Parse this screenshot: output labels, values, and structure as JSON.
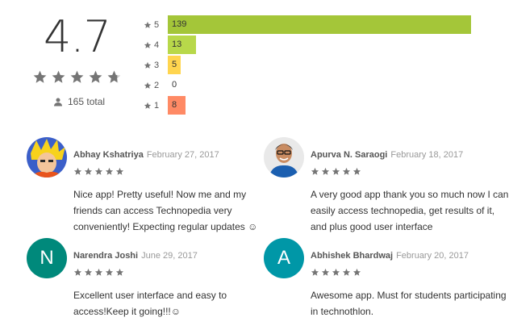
{
  "summary": {
    "score": "4.7",
    "total": "165 total",
    "star_color": "#757575",
    "star_fill_fraction": 0.7
  },
  "bars": [
    {
      "label": "5",
      "count": "139",
      "value": 139,
      "color": "#a4c639"
    },
    {
      "label": "4",
      "count": "13",
      "value": 13,
      "color": "#b8d84a"
    },
    {
      "label": "3",
      "count": "5",
      "value": 5,
      "color": "#ffd54f"
    },
    {
      "label": "2",
      "count": "0",
      "value": 0,
      "color": "#ffb74d"
    },
    {
      "label": "1",
      "count": "8",
      "value": 8,
      "color": "#ff8a65"
    }
  ],
  "reviews": [
    {
      "name": "Abhay Kshatriya",
      "date": "February 27, 2017",
      "stars": 5,
      "text": "Nice app! Pretty useful! Now me and my friends can access Technopedia very conveniently! Expecting regular updates ☺",
      "avatar_type": "photo",
      "avatar_letter": ""
    },
    {
      "name": "Apurva N. Saraogi",
      "date": "February 18, 2017",
      "stars": 5,
      "text": "A very good app thank you so much now I can easily access technopedia, get results of it, and plus good user interface",
      "avatar_type": "photo",
      "avatar_letter": ""
    },
    {
      "name": "Narendra Joshi",
      "date": "June 29, 2017",
      "stars": 5,
      "text": "Excellent user interface and easy to access!Keep it going!!!☺",
      "avatar_type": "letter",
      "avatar_letter": "N"
    },
    {
      "name": "Abhishek Bhardwaj",
      "date": "February 20, 2017",
      "stars": 5,
      "text": "Awesome app. Must for students participating in technothlon.",
      "avatar_type": "letter",
      "avatar_letter": "A"
    }
  ]
}
